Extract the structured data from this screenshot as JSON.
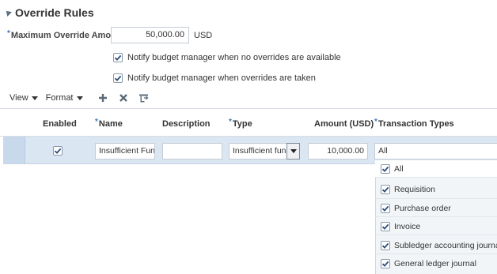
{
  "section": {
    "title": "Override Rules"
  },
  "form": {
    "max_amount_label": "Maximum Override Amount",
    "max_amount_value": "50,000.00",
    "currency": "USD",
    "notify_no_overrides_label": "Notify budget manager when no overrides are available",
    "notify_no_overrides_checked": true,
    "notify_taken_label": "Notify budget manager when overrides are taken",
    "notify_taken_checked": true
  },
  "toolbar": {
    "view_label": "View",
    "format_label": "Format",
    "add_icon": "plus-icon",
    "delete_icon": "x-icon",
    "detach_icon": "detach-icon"
  },
  "table": {
    "columns": [
      "Enabled",
      "Name",
      "Description",
      "Type",
      "Amount (USD)",
      "Transaction Types"
    ],
    "required_columns": [
      "Name",
      "Type",
      "Transaction Types"
    ],
    "row": {
      "enabled": true,
      "name": "Insufficient Func",
      "description": "",
      "type": "Insufficient funds",
      "amount": "10,000.00",
      "transaction_types": "All"
    }
  },
  "transaction_types_list": [
    {
      "label": "All",
      "checked": true
    },
    {
      "label": "Requisition",
      "checked": true
    },
    {
      "label": "Purchase order",
      "checked": true
    },
    {
      "label": "Invoice",
      "checked": true
    },
    {
      "label": "Subledger accounting journal",
      "checked": true
    },
    {
      "label": "General ledger journal",
      "checked": true
    }
  ],
  "colors": {
    "required_star": "#3b74c4",
    "selected_row": "#dbe6f3",
    "text": "#333333"
  }
}
